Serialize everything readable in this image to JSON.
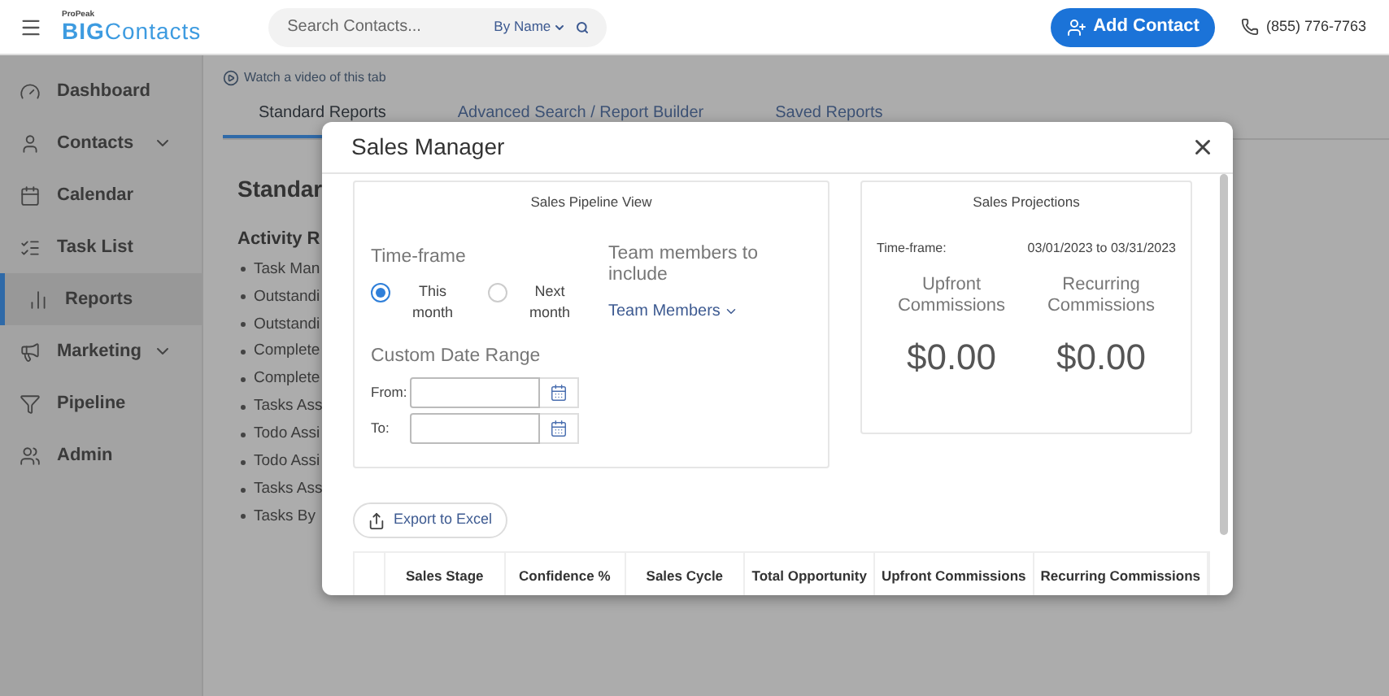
{
  "header": {
    "logo": {
      "tagline": "ProPeak",
      "brand_strong": "BIG",
      "brand_light": "Contacts"
    },
    "search": {
      "placeholder": "Search Contacts...",
      "mode": "By Name"
    },
    "add_button": "Add Contact",
    "phone": "(855) 776-7763"
  },
  "sidebar": {
    "items": [
      {
        "label": "Dashboard",
        "selected": false,
        "has_submenu": false
      },
      {
        "label": "Contacts",
        "selected": false,
        "has_submenu": true
      },
      {
        "label": "Calendar",
        "selected": false,
        "has_submenu": false
      },
      {
        "label": "Task List",
        "selected": false,
        "has_submenu": false
      },
      {
        "label": "Reports",
        "selected": true,
        "has_submenu": false
      },
      {
        "label": "Marketing",
        "selected": false,
        "has_submenu": true
      },
      {
        "label": "Pipeline",
        "selected": false,
        "has_submenu": false
      },
      {
        "label": "Admin",
        "selected": false,
        "has_submenu": false
      }
    ]
  },
  "main": {
    "video_link": "Watch a video of this tab",
    "tabs": [
      {
        "label": "Standard Reports",
        "selected": true
      },
      {
        "label": "Advanced Search / Report Builder",
        "selected": false
      },
      {
        "label": "Saved Reports",
        "selected": false
      }
    ],
    "heading": "Standar",
    "section": "Activity R",
    "reports": [
      "Task Man",
      "Outstandi",
      "Outstandi",
      "Complete",
      "Complete",
      "Tasks Ass",
      "Todo Assi",
      "Todo Assi",
      "Tasks Ass",
      "Tasks By"
    ]
  },
  "modal": {
    "title": "Sales Manager",
    "pipeline_view": {
      "title": "Sales Pipeline View",
      "timeframe_label": "Time-frame",
      "timeframes": [
        {
          "label": "This month",
          "selected": true
        },
        {
          "label": "Next month",
          "selected": false
        }
      ],
      "team_label": "Team members to include",
      "team_dropdown": "Team Members",
      "custom_range_label": "Custom Date Range",
      "from_label": "From:",
      "to_label": "To:"
    },
    "projections": {
      "title": "Sales Projections",
      "timeframe_label": "Time-frame:",
      "timeframe_value": "03/01/2023 to 03/31/2023",
      "metrics": [
        {
          "label": "Upfront Commissions",
          "value": "$0.00"
        },
        {
          "label": "Recurring Commissions",
          "value": "$0.00"
        }
      ]
    },
    "export_button": "Export to Excel",
    "table": {
      "columns": [
        "Sales Stage",
        "Confidence %",
        "Sales Cycle",
        "Total Opportunity",
        "Upfront Commissions",
        "Recurring Commissions"
      ]
    }
  }
}
